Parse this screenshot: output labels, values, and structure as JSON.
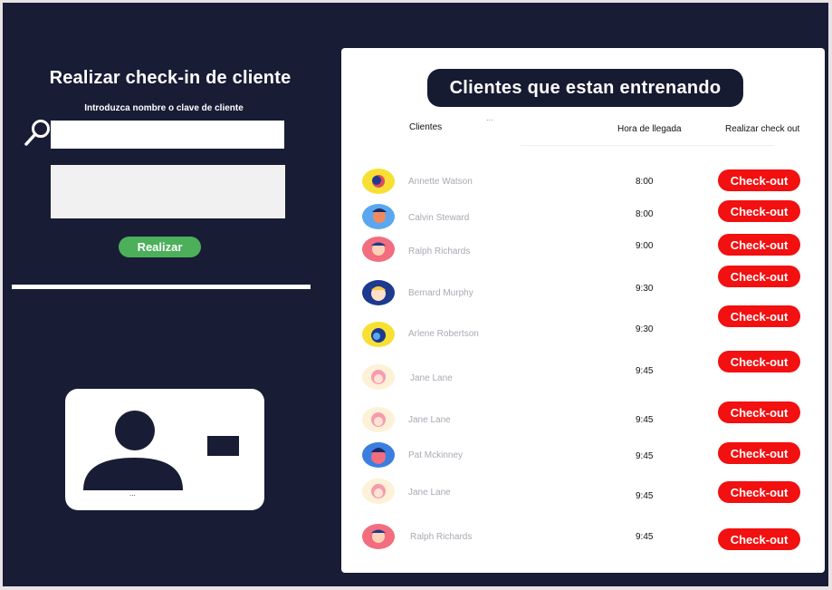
{
  "checkin": {
    "title": "Realizar check-in de cliente",
    "subtitle": "Introduzca nombre o clave de cliente",
    "search_value": "",
    "notes_value": "",
    "submit_label": "Realizar"
  },
  "list": {
    "title": "Clientes que estan entrenando",
    "col_clients": "Clientes",
    "col_dots": "...",
    "col_arrival": "Hora de llegada",
    "col_checkout": "Realizar check out",
    "rows": [
      {
        "name": "Annette Watson",
        "time": "8:00",
        "button": "Check-out"
      },
      {
        "name": "Calvin Steward",
        "time": "8:00",
        "button": "Check-out"
      },
      {
        "name": "Ralph Richards",
        "time": "9:00",
        "button": "Check-out"
      },
      {
        "name": "Bernard Murphy",
        "time": "9:30",
        "button": "Check-out"
      },
      {
        "name": "Arlene Robertson",
        "time": "9:30",
        "button": "Check-out"
      },
      {
        "name": "Jane Lane",
        "time": "9:45",
        "button": "Check-out"
      },
      {
        "name": "Jane Lane",
        "time": "9:45",
        "button": "Check-out"
      },
      {
        "name": "Pat Mckinney",
        "time": "9:45",
        "button": "Check-out"
      },
      {
        "name": "Jane Lane",
        "time": "9:45",
        "button": "Check-out"
      },
      {
        "name": "Ralph Richards",
        "time": "9:45",
        "button": "Check-out"
      }
    ]
  },
  "id_card": {
    "caption": "..."
  },
  "icons": {
    "search": "search-icon",
    "avatar": "avatar",
    "card_person": "person-icon"
  },
  "colors": {
    "background": "#181d35",
    "accent_green": "#4caf5a",
    "checkout_red": "#f21010"
  }
}
